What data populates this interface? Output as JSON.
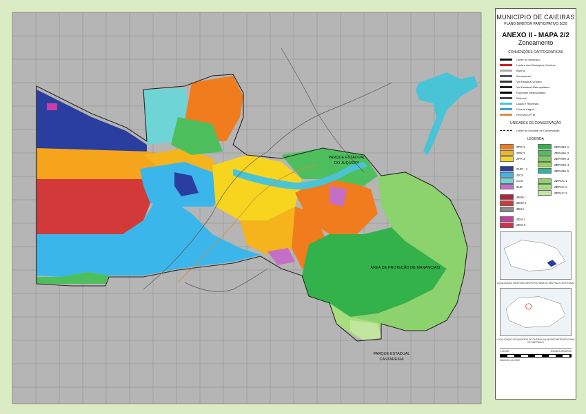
{
  "legend": {
    "municipality": "MUNICÍPIO DE CAIEIRAS",
    "plan": "PLANO DIRETOR PARTICIPATIVO 2020",
    "annex": "ANEXO II - MAPA 2/2",
    "map_title": "Zoneamento",
    "conventions_title": "CONVENÇÕES CARTOGRÁFICAS",
    "conventions": [
      {
        "label": "Limite do Município",
        "color": "#111111"
      },
      {
        "label": "Limites dos Municípios Vizinhos",
        "color": "#cc2222"
      },
      {
        "label": "Bairros",
        "color": "#aaaaaa"
      },
      {
        "label": "Arruamento",
        "color": "#555555"
      },
      {
        "label": "Via Estadual Urbana",
        "color": "#333333"
      },
      {
        "label": "Via Estadual Metropolitana",
        "color": "#222222"
      },
      {
        "label": "Rodoanel Metropolitano",
        "color": "#000000"
      },
      {
        "label": "Rodovia",
        "color": "#444444"
      },
      {
        "label": "Lagos e Represas",
        "color": "#49c3d6"
      },
      {
        "label": "Cursos d'água",
        "color": "#3a9fd6"
      },
      {
        "label": "Ferrovia CPTM",
        "color": "#e08a3c"
      }
    ],
    "uc_title": "UNIDADES DE CONSERVAÇÃO",
    "uc_item": "Limite de Unidade de Conservação",
    "legend_title": "LEGENDA",
    "zones_left": [
      {
        "label": "ZPR 1",
        "color": "#f07c1e"
      },
      {
        "label": "ZPR 7",
        "color": "#f5b41c"
      },
      {
        "label": "ZPR 3",
        "color": "#f7d51e"
      },
      {
        "label": "",
        "color": ""
      },
      {
        "label": "ZUPI - 1",
        "color": "#2a3ea0"
      },
      {
        "label": "ZICS",
        "color": "#3bb6ea"
      },
      {
        "label": "CCS",
        "color": "#6fd4d6"
      },
      {
        "label": "ZUD",
        "color": "#c46fc7"
      },
      {
        "label": "",
        "color": ""
      },
      {
        "label": "ZEIM I",
        "color": "#b8213a"
      },
      {
        "label": "ZEIM II",
        "color": "#d23a3a"
      },
      {
        "label": "ZESA",
        "color": "#8a8a8a"
      },
      {
        "label": "",
        "color": ""
      },
      {
        "label": "ZEIS I",
        "color": "#c93da6"
      },
      {
        "label": "ZEIS II",
        "color": "#d62d4b"
      }
    ],
    "zones_right": [
      {
        "label": "ZEPARH 1",
        "color": "#33b14a"
      },
      {
        "label": "ZEPARH 2",
        "color": "#4dbf5c"
      },
      {
        "label": "ZEPARH 3",
        "color": "#7ccd5a"
      },
      {
        "label": "ZEPARH 4",
        "color": "#9ad45a"
      },
      {
        "label": "ZEPARH 5",
        "color": "#2fb3a0"
      },
      {
        "label": "",
        "color": ""
      },
      {
        "label": "ZEPUC 1",
        "color": "#8cd36e"
      },
      {
        "label": "ZEPUC 2",
        "color": "#a8dd7e"
      },
      {
        "label": "ZEPUC 3",
        "color": "#c2e6a0"
      }
    ],
    "loc1_caption": "LOCALIZAÇÃO DA REGIÃO METROPOLITANA DE SÃO PAULO NO ESTADO",
    "loc2_caption": "LOCALIZAÇÃO DO MUNICÍPIO DE CAIEIRAS NA REGIÃO METROPOLITANA DE SÃO PAULO",
    "scale_text": "1:20.000",
    "date_text": "Setembro de 2020",
    "scale_label": "ESCALA GRÁFICA"
  },
  "map_labels": {
    "park_north_1": "PARQUE ESTADUAL",
    "park_north_2": "DO JUQUERY",
    "apm": "ÁREA DE PROTEÇÃO DE MANANCIAIS",
    "park_south_1": "PARQUE ESTADUAL",
    "park_south_2": "CANTAREIRA"
  },
  "colors": {
    "background": "#d9ecc4",
    "map_bg": "#b5b5b5",
    "grid": "#8c8c8c"
  }
}
